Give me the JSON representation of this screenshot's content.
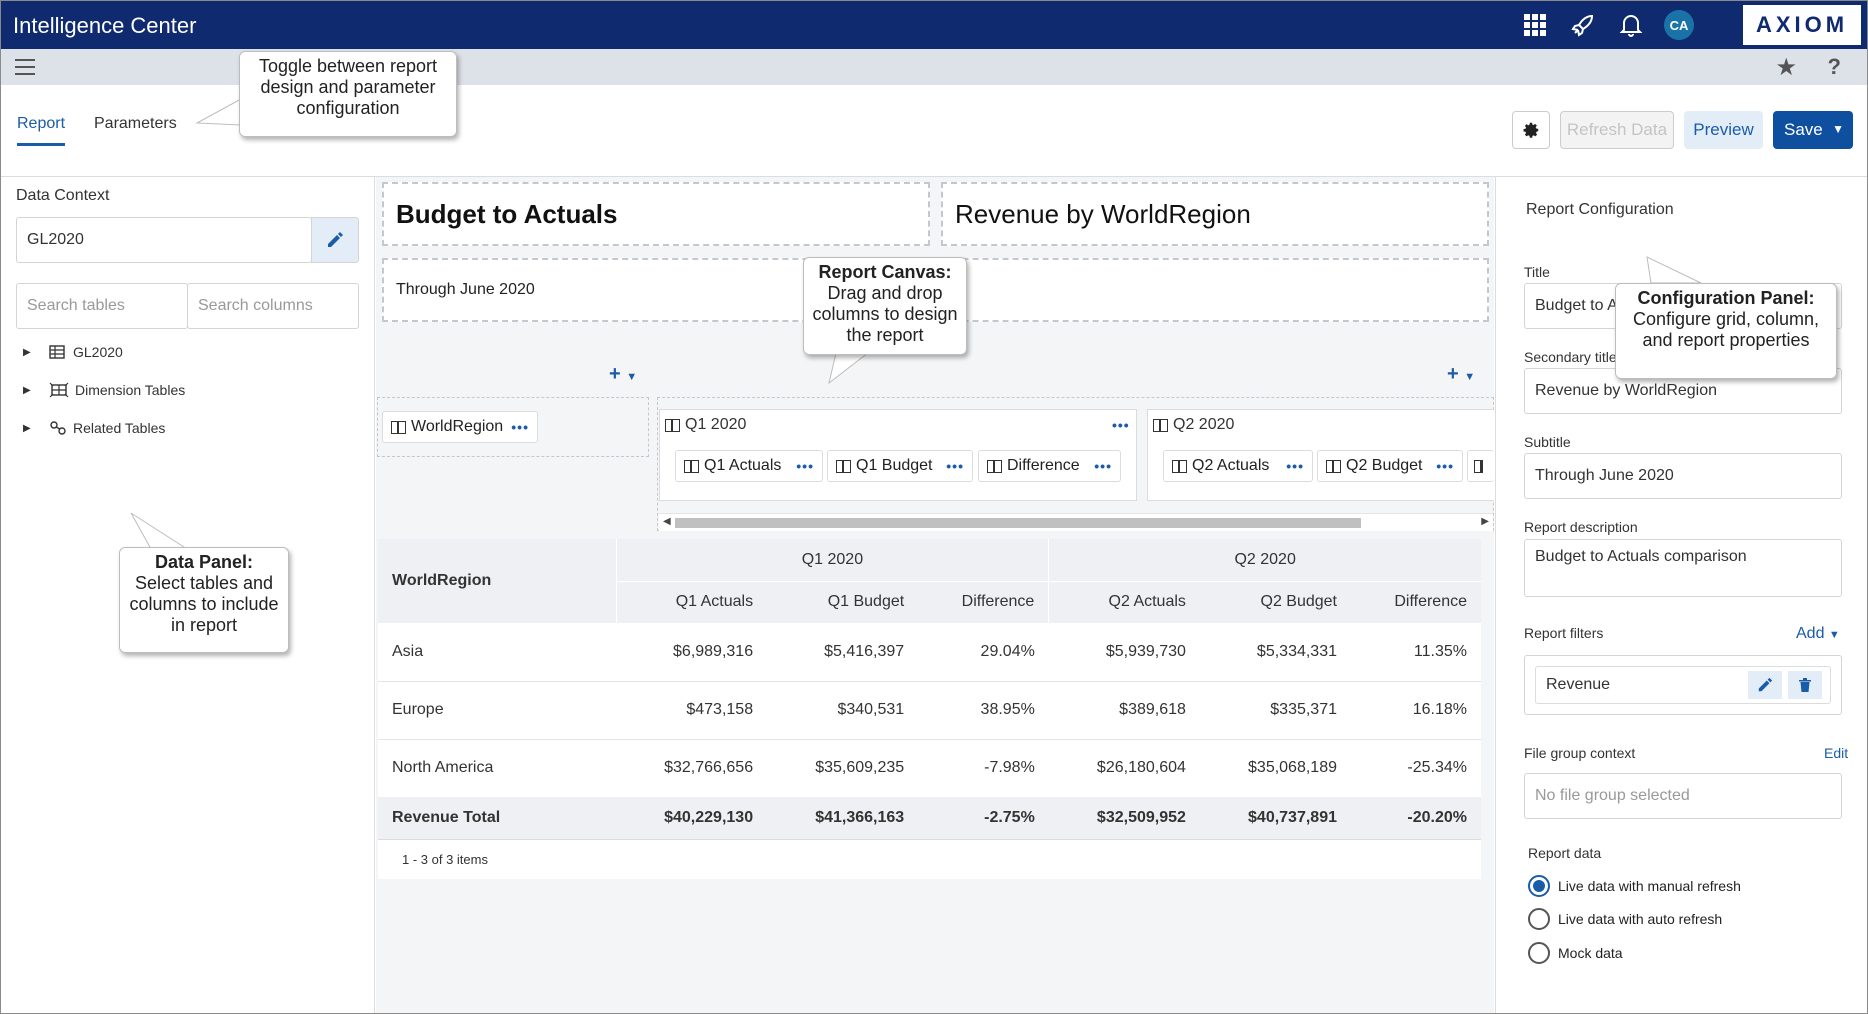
{
  "app": {
    "title": "Intelligence Center",
    "brand": "AXIOM",
    "avatar": "CA"
  },
  "topbar_icons": [
    "apps-grid-icon",
    "rocket-icon",
    "bell-icon"
  ],
  "graybar_icons": [
    "hamburger-menu-icon",
    "star-icon",
    "help-icon"
  ],
  "tabs": [
    {
      "label": "Report",
      "active": true
    },
    {
      "label": "Parameters",
      "active": false
    }
  ],
  "toolbar": {
    "settings_icon": "gear-icon",
    "refresh_label": "Refresh Data",
    "preview_label": "Preview",
    "save_label": "Save"
  },
  "data_panel": {
    "context_label": "Data Context",
    "context_value": "GL2020",
    "search_tables_placeholder": "Search tables",
    "search_columns_placeholder": "Search columns",
    "tree": [
      {
        "label": "GL2020",
        "icon": "table-icon"
      },
      {
        "label": "Dimension Tables",
        "icon": "dimension-table-icon"
      },
      {
        "label": "Related Tables",
        "icon": "link-icon"
      }
    ]
  },
  "canvas": {
    "title": "Budget to Actuals",
    "secondary_title": "Revenue by WorldRegion",
    "subtitle": "Through June 2020",
    "row_chip": "WorldRegion",
    "groups": [
      {
        "label": "Q1 2020",
        "columns": [
          "Q1 Actuals",
          "Q1 Budget",
          "Difference"
        ]
      },
      {
        "label": "Q2 2020",
        "columns": [
          "Q2 Actuals",
          "Q2 Budget"
        ]
      }
    ]
  },
  "grid": {
    "row_header": "WorldRegion",
    "groups": [
      "Q1 2020",
      "Q2 2020"
    ],
    "columns": [
      "Q1 Actuals",
      "Q1 Budget",
      "Difference",
      "Q2 Actuals",
      "Q2 Budget",
      "Difference"
    ],
    "rows": [
      {
        "region": "Asia",
        "values": [
          "$6,989,316",
          "$5,416,397",
          "29.04%",
          "$5,939,730",
          "$5,334,331",
          "11.35%"
        ]
      },
      {
        "region": "Europe",
        "values": [
          "$473,158",
          "$340,531",
          "38.95%",
          "$389,618",
          "$335,371",
          "16.18%"
        ]
      },
      {
        "region": "North America",
        "values": [
          "$32,766,656",
          "$35,609,235",
          "-7.98%",
          "$26,180,604",
          "$35,068,189",
          "-25.34%"
        ]
      }
    ],
    "total": {
      "region": "Revenue Total",
      "values": [
        "$40,229,130",
        "$41,366,163",
        "-2.75%",
        "$32,509,952",
        "$40,737,891",
        "-20.20%"
      ]
    },
    "pager": "1 - 3 of 3 items"
  },
  "config": {
    "heading": "Report Configuration",
    "title_label": "Title",
    "title_value": "Budget to A",
    "secondary_label": "Secondary title",
    "secondary_value": "Revenue by WorldRegion",
    "subtitle_label": "Subtitle",
    "subtitle_value": "Through June 2020",
    "description_label": "Report description",
    "description_value": "Budget to Actuals comparison",
    "filters_label": "Report filters",
    "filters_add": "Add",
    "filter_item": "Revenue",
    "file_group_label": "File group context",
    "file_group_edit": "Edit",
    "file_group_placeholder": "No file group selected",
    "report_data_label": "Report data",
    "report_data_options": [
      {
        "label": "Live data with manual refresh",
        "selected": true
      },
      {
        "label": "Live data with auto refresh",
        "selected": false
      },
      {
        "label": "Mock data",
        "selected": false
      }
    ]
  },
  "callouts": {
    "toggle": "Toggle between report design and parameter configuration",
    "canvas_title": "Report Canvas:",
    "canvas_body": "Drag and drop columns to design the report",
    "data_title": "Data Panel:",
    "data_body": "Select tables and columns to include in report",
    "config_title": "Configuration Panel:",
    "config_body": "Configure grid, column, and report properties"
  }
}
